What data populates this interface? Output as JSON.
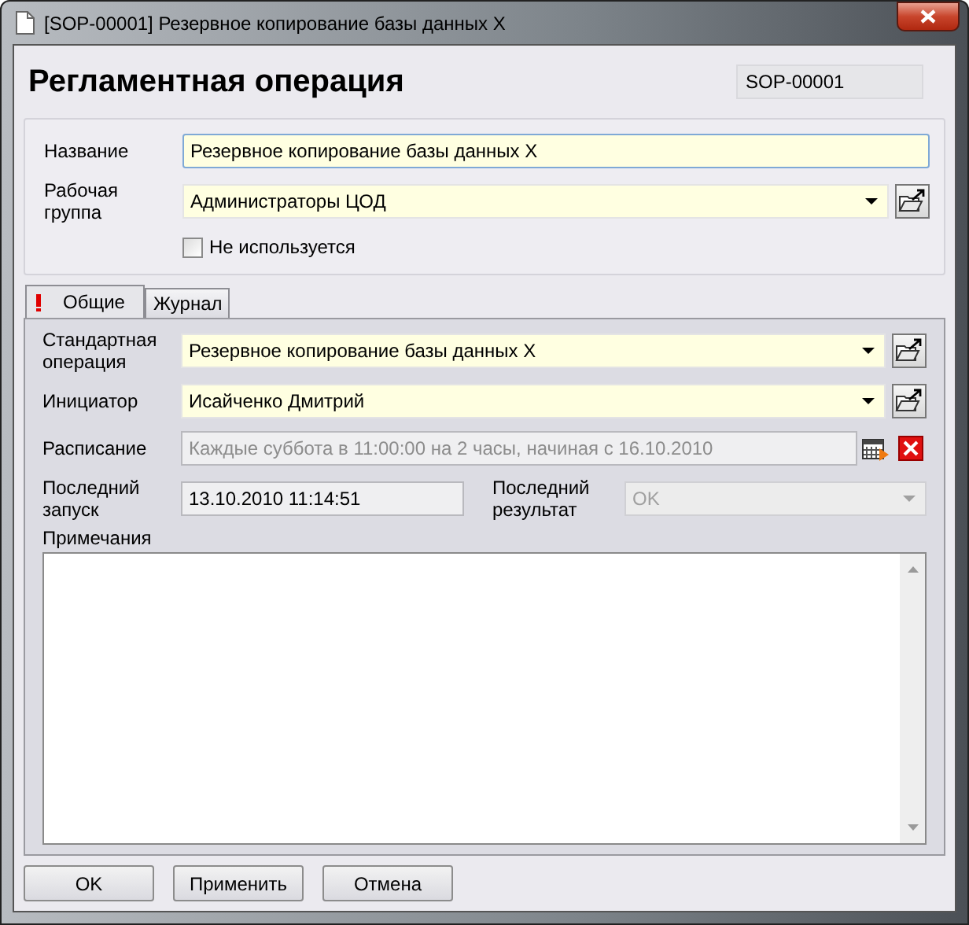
{
  "window": {
    "title": "[SOP-00001] Резервное копирование базы данных X"
  },
  "header": {
    "title": "Регламентная операция",
    "code": "SOP-00001"
  },
  "general": {
    "name": {
      "label": "Название",
      "value": "Резервное копирование базы данных X"
    },
    "group": {
      "label": "Рабочая группа",
      "value": "Администраторы ЦОД"
    },
    "unused": {
      "label": "Не используется",
      "checked": false
    }
  },
  "tabs": [
    {
      "label": "Общие",
      "selected": true,
      "warning": true
    },
    {
      "label": "Журнал",
      "selected": false,
      "warning": false
    }
  ],
  "fields": [
    {
      "kind": "combo",
      "label": "Стандартная операция",
      "value": "Резервное копирование базы данных X"
    },
    {
      "kind": "combo",
      "label": "Инициатор",
      "value": "Исайченко Дмитрий"
    },
    {
      "kind": "schedule",
      "label": "Расписание",
      "value": "Каждые суббота в 11:00:00 на 2 часы, начиная с 16.10.2010"
    }
  ],
  "last_run": {
    "label": "Последний запуск",
    "value": "13.10.2010 11:14:51"
  },
  "last_result": {
    "label": "Последний результат",
    "value": "OK",
    "disabled": true
  },
  "notes": {
    "label": "Примечания"
  },
  "buttons": [
    "OK",
    "Применить",
    "Отмена"
  ]
}
